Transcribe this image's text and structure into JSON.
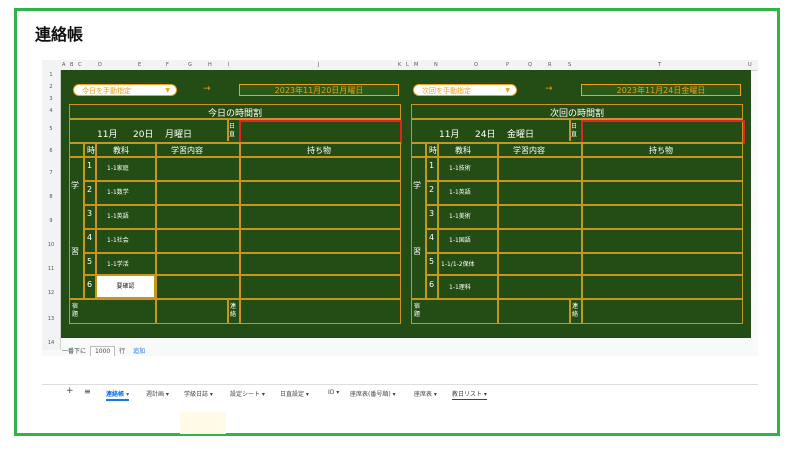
{
  "page_title": "連絡帳",
  "col_headers": [
    "A",
    "B",
    "C",
    "D",
    "E",
    "F",
    "G",
    "H",
    "I",
    "J",
    "K",
    "L",
    "M",
    "N",
    "O",
    "P",
    "Q",
    "R",
    "S",
    "T",
    "U"
  ],
  "row_headers": [
    "1",
    "2",
    "3",
    "4",
    "5",
    "6",
    "7",
    "8",
    "9",
    "10",
    "11",
    "12",
    "13",
    "14"
  ],
  "today": {
    "selector": "今日を手動指定",
    "arrow": "→",
    "date_full": "2023年11月20日月曜日",
    "section_title": "今日の時間割",
    "month": "11月",
    "day": "20日",
    "weekday": "月曜日",
    "nikki_label": "日直",
    "headers": {
      "period": "時",
      "subject": "教科",
      "content": "学習内容",
      "items": "持ち物"
    },
    "side_label": "学習",
    "periods": [
      {
        "num": "1",
        "subject": "1-1家庭"
      },
      {
        "num": "2",
        "subject": "1-1数学"
      },
      {
        "num": "3",
        "subject": "1-1英語"
      },
      {
        "num": "4",
        "subject": "1-1社会"
      },
      {
        "num": "5",
        "subject": "1-1学活"
      },
      {
        "num": "6",
        "subject": "要確認"
      }
    ],
    "homework_label": "宿題",
    "contact_label": "連絡"
  },
  "next": {
    "selector": "次回を手動指定",
    "arrow": "→",
    "date_full": "2023年11月24日金曜日",
    "section_title": "次回の時間割",
    "month": "11月",
    "day": "24日",
    "weekday": "金曜日",
    "nikki_label": "日直",
    "headers": {
      "period": "時",
      "subject": "教科",
      "content": "学習内容",
      "items": "持ち物"
    },
    "side_label": "学習",
    "periods": [
      {
        "num": "1",
        "subject": "1-1技術"
      },
      {
        "num": "2",
        "subject": "1-1英語"
      },
      {
        "num": "3",
        "subject": "1-1美術"
      },
      {
        "num": "4",
        "subject": "1-1国語"
      },
      {
        "num": "5",
        "subject": "1-1/1-2保体"
      },
      {
        "num": "6",
        "subject": "1-1理科"
      }
    ],
    "homework_label": "宿題",
    "contact_label": "連絡"
  },
  "footer": {
    "prefix": "一番下に",
    "rows_value": "1000",
    "suffix": "行",
    "add": "追加"
  },
  "sheet_tabs": [
    "連絡帳",
    "週計画",
    "学級日誌",
    "設定シート",
    "日直設定",
    "ID",
    "座席表(番号順)",
    "座席表",
    "教日リスト"
  ],
  "colors": {
    "board": "#234d14",
    "gold": "#c8961e",
    "accent": "#f39c12",
    "highlight": "#e02424",
    "frame": "#2fb34a"
  }
}
